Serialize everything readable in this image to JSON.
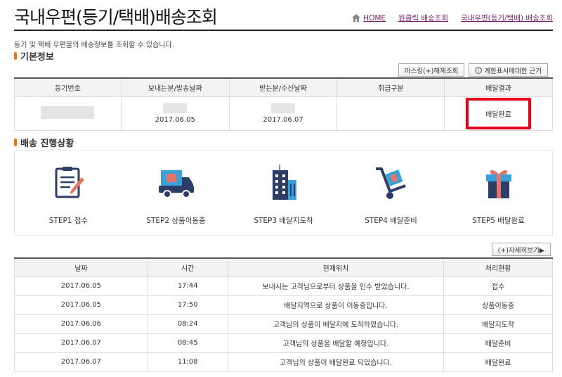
{
  "header": {
    "title": "국내우편(등기/택배)배송조회",
    "nav": [
      {
        "label": "HOME"
      },
      {
        "label": "원클릭 배송조회"
      },
      {
        "label": "국내우편(등기/택배) 배송조회"
      }
    ]
  },
  "description": "등기 및 택배 우편물의 배송정보를 조회할 수 있습니다.",
  "basic_info": {
    "section_title": "기본정보",
    "buttons": {
      "masking": "마스킹(+)해제조회",
      "limit_info": "계한표시에대한 근거",
      "limit_icon": "ⓘ"
    },
    "columns": [
      "등기번호",
      "보내는분/발송날짜",
      "받는분/수신날짜",
      "취급구분",
      "배달결과"
    ],
    "row": {
      "sender_date": "2017.06.05",
      "receiver_date": "2017.06.07",
      "category": "",
      "result": "배달완료"
    }
  },
  "progress": {
    "section_title": "배송 진행상황",
    "steps": [
      {
        "label": "STEP1 접수",
        "icon": "clipboard-icon"
      },
      {
        "label": "STEP2 상품이동중",
        "icon": "truck-icon"
      },
      {
        "label": "STEP3 배달지도착",
        "icon": "building-icon"
      },
      {
        "label": "STEP4 배달준비",
        "icon": "hand-cart-icon"
      },
      {
        "label": "STEP5 배달완료",
        "icon": "gift-icon"
      }
    ]
  },
  "detail_button": "(+)자세히보기▶",
  "history": {
    "columns": [
      "날짜",
      "시간",
      "현재위치",
      "처리현황"
    ],
    "rows": [
      {
        "date": "2017.06.05",
        "time": "17:44",
        "location": "보내시는 고객님으로부터 상품을 인수 받았습니다.",
        "status": "접수"
      },
      {
        "date": "2017.06.05",
        "time": "17:50",
        "location": "배달지역으로 상품이 이동중입니다.",
        "status": "상품이동중"
      },
      {
        "date": "2017.06.06",
        "time": "08:24",
        "location": "고객님의 상품이 배달지에 도착하였습니다.",
        "status": "배달지도착"
      },
      {
        "date": "2017.06.07",
        "time": "08:45",
        "location": "고객님의 상품을 배달할 예정입니다.",
        "status": "배달준비"
      },
      {
        "date": "2017.06.07",
        "time": "11:08",
        "location": "고객님의 상품이 배달완료 되었습니다.",
        "status": "배달완료"
      }
    ]
  },
  "colors": {
    "accent": "#e07a1a",
    "nav_link": "#7a1f6a",
    "highlight": "#e3001b",
    "icon_navy": "#2c3e66"
  }
}
